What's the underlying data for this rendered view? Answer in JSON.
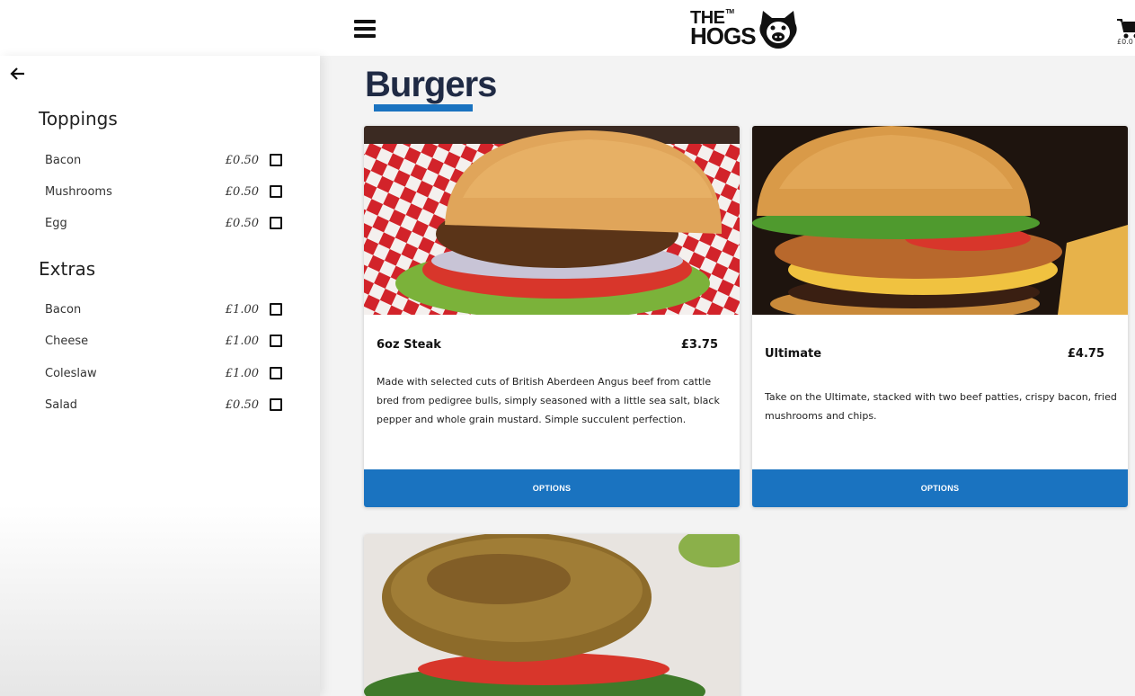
{
  "header": {
    "logo_the": "THE",
    "logo_tm": "TM",
    "logo_hogs": "HOGS",
    "cart_total": "£0.0"
  },
  "sidebar": {
    "toppings_title": "Toppings",
    "toppings": [
      {
        "name": "Bacon",
        "price": "£0.50"
      },
      {
        "name": "Mushrooms",
        "price": "£0.50"
      },
      {
        "name": "Egg",
        "price": "£0.50"
      }
    ],
    "extras_title": "Extras",
    "extras": [
      {
        "name": "Bacon",
        "price": "£1.00"
      },
      {
        "name": "Cheese",
        "price": "£1.00"
      },
      {
        "name": "Coleslaw",
        "price": "£1.00"
      },
      {
        "name": "Salad",
        "price": "£0.50"
      }
    ]
  },
  "main": {
    "title": "Burgers",
    "products": [
      {
        "name": "6oz Steak",
        "price": "£3.75",
        "description": "Made with selected cuts of British Aberdeen Angus beef from cattle bred from pedigree bulls, simply seasoned with a little sea salt, black pepper and whole grain mustard. Simple succulent perfection.",
        "button": "OPTIONS"
      },
      {
        "name": "Ultimate",
        "price": "£4.75",
        "description": "Take on the Ultimate, stacked with two beef patties, crispy bacon, fried mushrooms and chips.",
        "button": "OPTIONS"
      }
    ]
  },
  "colors": {
    "accent": "#1a73c0",
    "title": "#1f2a44"
  },
  "icons": {
    "menu": "hamburger-menu-icon",
    "cart": "cart-icon",
    "back": "back-arrow-icon",
    "logo": "pig-logo-icon"
  }
}
